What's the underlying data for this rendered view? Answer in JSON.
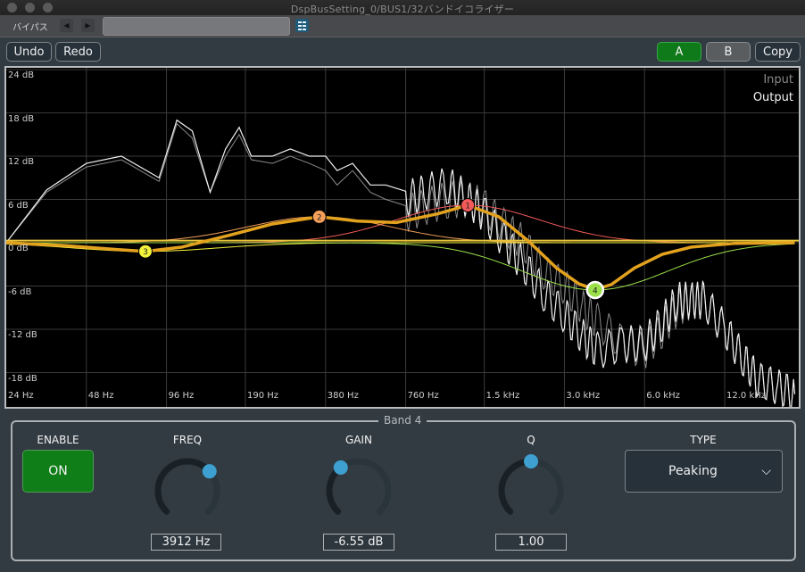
{
  "window": {
    "title": "DspBusSetting_0/BUS1/32バンドイコライザー"
  },
  "toolbar": {
    "bypass_label": "バイパス",
    "prev_icon": "triangle-left-icon",
    "next_icon": "triangle-right-icon",
    "preset_value": "",
    "list_icon": "list-icon"
  },
  "actions": {
    "undo_label": "Undo",
    "redo_label": "Redo",
    "a_label": "A",
    "b_label": "B",
    "copy_label": "Copy",
    "active_slot": "A"
  },
  "colors": {
    "accent_green": "#0e7a19",
    "curve_total": "#e3a21e",
    "band1": "#f25a5a",
    "band2": "#f5a05a",
    "band3": "#f2f23c",
    "band4": "#9be04a",
    "knob_dot": "#3ea0d0"
  },
  "chart_data": {
    "type": "line",
    "title": "",
    "xscale": "log",
    "xlim_hz": [
      24,
      22000
    ],
    "ylim_db": [
      -21,
      24
    ],
    "x_ticks": [
      "24 Hz",
      "48 Hz",
      "96 Hz",
      "190 Hz",
      "380 Hz",
      "760 Hz",
      "1.5 kHz",
      "3.0 kHz",
      "6.0 kHz",
      "12.0 kHz"
    ],
    "x_tick_values": [
      24,
      48,
      96,
      190,
      380,
      760,
      1500,
      3000,
      6000,
      12000
    ],
    "y_ticks": [
      "24 dB",
      "18 dB",
      "12 dB",
      "6 dB",
      "0 dB",
      "-6 dB",
      "-12 dB",
      "-18 dB"
    ],
    "y_tick_values": [
      24,
      18,
      12,
      6,
      0,
      -6,
      -12,
      -18
    ],
    "grid": true,
    "legend": {
      "placement": "top-right",
      "entries": [
        "Input",
        "Output"
      ]
    },
    "bands": [
      {
        "id": "1",
        "freq_hz": 1300,
        "gain_db": 5.2,
        "q": 1.0
      },
      {
        "id": "2",
        "freq_hz": 360,
        "gain_db": 3.6,
        "q": 1.0
      },
      {
        "id": "3",
        "freq_hz": 80,
        "gain_db": -1.2,
        "q": 1.0
      },
      {
        "id": "4",
        "freq_hz": 3912,
        "gain_db": -6.55,
        "q": 1.0
      }
    ],
    "series": [
      {
        "name": "Input",
        "x": [
          24,
          34,
          48,
          65,
          90,
          105,
          120,
          140,
          160,
          180,
          200,
          240,
          280,
          330,
          380,
          420,
          480,
          560,
          640,
          760,
          900,
          1100,
          1300,
          1500,
          1800,
          2100,
          2500,
          3000,
          3500,
          4000,
          5000,
          6000,
          7000,
          8000,
          9000,
          10000,
          12000,
          14000,
          16000,
          19000,
          22000
        ],
        "y": [
          0,
          7,
          10.5,
          11.5,
          8.5,
          16.5,
          14.5,
          7,
          12,
          15,
          11.5,
          11,
          12,
          11,
          10,
          8,
          10,
          7,
          6,
          4,
          5,
          6,
          6,
          5,
          2,
          0,
          -4,
          -6,
          -9,
          -11,
          -14,
          -15,
          -12,
          -9,
          -8,
          -8,
          -12,
          -16,
          -19,
          -20,
          -21
        ]
      },
      {
        "name": "Output",
        "x": [
          24,
          34,
          48,
          65,
          90,
          105,
          120,
          140,
          160,
          180,
          200,
          240,
          280,
          330,
          380,
          420,
          480,
          560,
          640,
          760,
          900,
          1100,
          1300,
          1500,
          1800,
          2100,
          2500,
          3000,
          3500,
          4000,
          5000,
          6000,
          7000,
          8000,
          9000,
          10000,
          12000,
          14000,
          16000,
          19000,
          22000
        ],
        "y": [
          0,
          7.3,
          11,
          12,
          9,
          17,
          15.5,
          7,
          13,
          16,
          12,
          12,
          13,
          12,
          12,
          10,
          11,
          8,
          8,
          6,
          7,
          8,
          6,
          4,
          0,
          -3,
          -7,
          -10,
          -13,
          -15,
          -14,
          -14,
          -11,
          -8,
          -8,
          -8,
          -12,
          -16,
          -19,
          -20,
          -21
        ]
      },
      {
        "name": "EQ Total",
        "x": [
          24,
          40,
          60,
          80,
          110,
          160,
          240,
          360,
          500,
          700,
          1000,
          1300,
          1700,
          2200,
          2800,
          3400,
          3912,
          4500,
          5500,
          7000,
          9000,
          13000,
          22000
        ],
        "y": [
          0,
          -0.4,
          -0.9,
          -1.2,
          -0.6,
          0.9,
          2.6,
          3.6,
          3.0,
          2.8,
          4.0,
          5.2,
          3.6,
          0.2,
          -3.5,
          -5.7,
          -6.5,
          -5.8,
          -3.5,
          -1.6,
          -0.6,
          -0.1,
          0
        ]
      }
    ]
  },
  "band_panel": {
    "title": "Band 4",
    "enable_label": "ENABLE",
    "enable_value": "ON",
    "freq_label": "FREQ",
    "freq_value": "3912 Hz",
    "freq_knob_fraction": 0.68,
    "gain_label": "GAIN",
    "gain_value": "-6.55 dB",
    "gain_knob_fraction": 0.36,
    "q_label": "Q",
    "q_value": "1.00",
    "q_knob_fraction": 0.5,
    "type_label": "TYPE",
    "type_value": "Peaking"
  }
}
